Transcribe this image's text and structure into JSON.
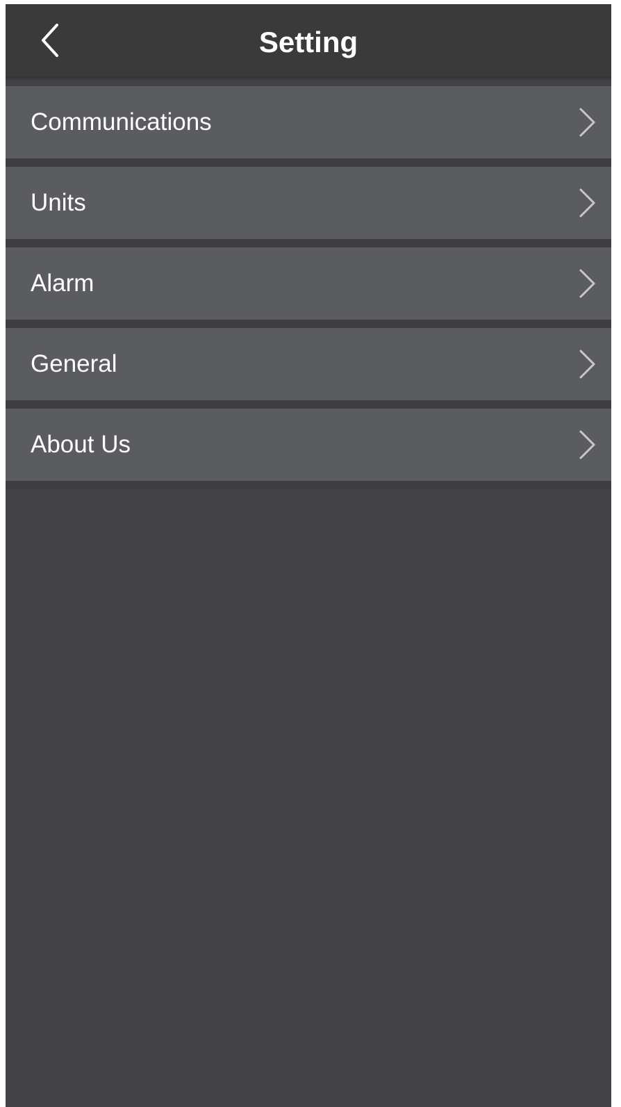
{
  "header": {
    "title": "Setting",
    "back_icon": "chevron-left-icon"
  },
  "menu": {
    "items": [
      {
        "label": "Communications",
        "icon": "chevron-right-icon"
      },
      {
        "label": "Units",
        "icon": "chevron-right-icon"
      },
      {
        "label": "Alarm",
        "icon": "chevron-right-icon"
      },
      {
        "label": "General",
        "icon": "chevron-right-icon"
      },
      {
        "label": "About Us",
        "icon": "chevron-right-icon"
      }
    ]
  },
  "colors": {
    "header_bg": "#3a3a3b",
    "item_bg": "#5b5c60",
    "screen_bg": "#434247",
    "text": "#ffffff",
    "chevron": "#c9c9cc"
  }
}
